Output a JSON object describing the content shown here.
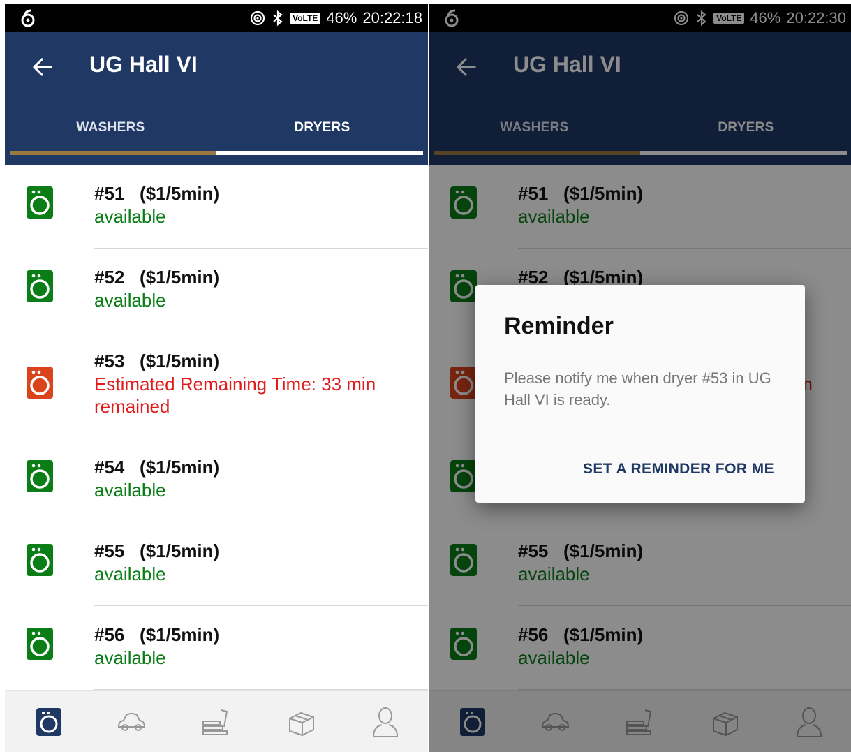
{
  "colors": {
    "app_bar": "#1f3864",
    "tab_indicator_active": "#ffffff",
    "tab_indicator_inactive": "#9b7a3f",
    "available": "#0a7d17",
    "busy": "#e01c1c",
    "icon_available": "#0a7d17",
    "icon_busy": "#d9441c"
  },
  "left": {
    "status": {
      "battery": "46%",
      "time": "20:22:18",
      "network_badge": "VoLTE"
    },
    "title": "UG Hall VI",
    "tabs": [
      {
        "label": "WASHERS",
        "active": false
      },
      {
        "label": "DRYERS",
        "active": true
      }
    ],
    "machines": [
      {
        "title": "#51   ($1/5min)",
        "status": "available",
        "state": "available",
        "icon": "dryer-icon"
      },
      {
        "title": "#52   ($1/5min)",
        "status": "available",
        "state": "available",
        "icon": "dryer-icon"
      },
      {
        "title": "#53   ($1/5min)",
        "status": "Estimated Remaining Time: 33 min remained",
        "state": "busy",
        "icon": "dryer-icon"
      },
      {
        "title": "#54   ($1/5min)",
        "status": "available",
        "state": "available",
        "icon": "dryer-icon"
      },
      {
        "title": "#55   ($1/5min)",
        "status": "available",
        "state": "available",
        "icon": "dryer-icon"
      },
      {
        "title": "#56   ($1/5min)",
        "status": "available",
        "state": "available",
        "icon": "dryer-icon"
      }
    ],
    "bottom_nav": [
      "laundry-icon",
      "car-icon",
      "books-icon",
      "box-icon",
      "profile-icon"
    ]
  },
  "right": {
    "status": {
      "battery": "46%",
      "time": "20:22:30",
      "network_badge": "VoLTE"
    },
    "title": "UG Hall VI",
    "tabs": [
      {
        "label": "WASHERS",
        "active": false
      },
      {
        "label": "DRYERS",
        "active": true
      }
    ],
    "machines": [
      {
        "title": "#51   ($1/5min)",
        "status": "available",
        "state": "available",
        "icon": "dryer-icon"
      },
      {
        "title": "#52   ($1/5min)",
        "status": "",
        "state": "available",
        "icon": "dryer-icon"
      },
      {
        "title": "",
        "status": "n",
        "state": "busy",
        "icon": "dryer-icon"
      },
      {
        "title": "",
        "status": "",
        "state": "available",
        "icon": "dryer-icon"
      },
      {
        "title": "#55   ($1/5min)",
        "status": "available",
        "state": "available",
        "icon": "dryer-icon"
      },
      {
        "title": "#56   ($1/5min)",
        "status": "available",
        "state": "available",
        "icon": "dryer-icon"
      }
    ],
    "dialog": {
      "title": "Reminder",
      "body": "Please notify me when dryer #53 in UG Hall VI is ready.",
      "action": "SET A REMINDER FOR ME"
    }
  }
}
